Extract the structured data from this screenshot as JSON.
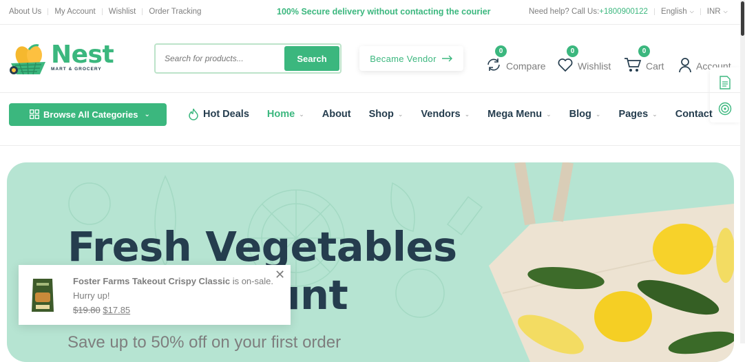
{
  "topbar": {
    "links": [
      "About Us",
      "My Account",
      "Wishlist",
      "Order Tracking"
    ],
    "promo": "100% Secure delivery without contacting the courier",
    "help_prefix": "Need help? Call Us:",
    "phone": " +1800900122",
    "language": "English",
    "currency": "INR"
  },
  "header": {
    "logo_word": "Nest",
    "logo_sub": "MART & GROCERY",
    "search_placeholder": "Search for products...",
    "search_button": "Search",
    "vendor_button": "Became Vendor",
    "compare_label": "Compare",
    "compare_count": "0",
    "wishlist_label": "Wishlist",
    "wishlist_count": "0",
    "cart_label": "Cart",
    "cart_count": "0",
    "account_label": "Account"
  },
  "nav": {
    "browse_label": "Browse All Categories",
    "hot_deals": "Hot Deals",
    "items": [
      "Home",
      "About",
      "Shop",
      "Vendors",
      "Mega Menu",
      "Blog",
      "Pages",
      "Contact"
    ]
  },
  "hero": {
    "title_line1": "Fresh Vegetables",
    "title_line2": "Big discount",
    "subtitle": "Save up to 50% off on your first order"
  },
  "toast": {
    "product_name": "Foster Farms Takeout Crispy Classic",
    "status": " is on-sale.",
    "hurry": "Hurry up!",
    "old_price": "$19.80",
    "new_price": "$17.85"
  },
  "colors": {
    "brand": "#3bb77e",
    "heading": "#253d4e",
    "hero_bg": "#b6e4d2",
    "muted": "#7e7e7e"
  }
}
